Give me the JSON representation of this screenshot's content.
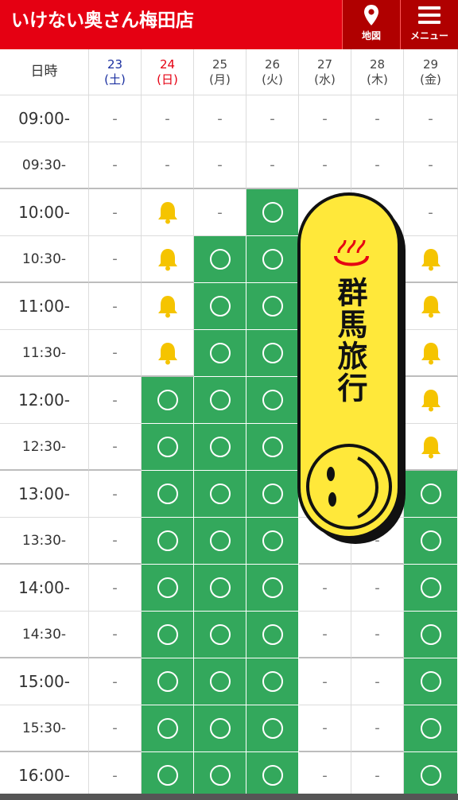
{
  "app": {
    "title": "いけない奥さん梅田店"
  },
  "nav": {
    "map_label": "地図",
    "menu_label": "メニュー",
    "map_icon": "map-pin-icon",
    "menu_icon": "hamburger-menu-icon"
  },
  "table": {
    "corner_label": "日時",
    "days": [
      {
        "date": "23",
        "weekday": "(土)",
        "type": "sat"
      },
      {
        "date": "24",
        "weekday": "(日)",
        "type": "sun"
      },
      {
        "date": "25",
        "weekday": "(月)",
        "type": "weekday"
      },
      {
        "date": "26",
        "weekday": "(火)",
        "type": "weekday"
      },
      {
        "date": "27",
        "weekday": "(水)",
        "type": "weekday"
      },
      {
        "date": "28",
        "weekday": "(木)",
        "type": "weekday"
      },
      {
        "date": "29",
        "weekday": "(金)",
        "type": "weekday"
      }
    ],
    "rows": [
      {
        "time": "09:00-",
        "cells": [
          "-",
          "-",
          "-",
          "-",
          "-",
          "-",
          "-"
        ]
      },
      {
        "time": "09:30-",
        "cells": [
          "-",
          "-",
          "-",
          "-",
          "-",
          "-",
          "-"
        ]
      },
      {
        "time": "10:00-",
        "cells": [
          "-",
          "bell",
          "-",
          "○",
          "",
          "",
          "-"
        ]
      },
      {
        "time": "10:30-",
        "cells": [
          "-",
          "bell",
          "○",
          "○",
          "",
          "",
          "bell"
        ]
      },
      {
        "time": "11:00-",
        "cells": [
          "-",
          "bell",
          "○",
          "○",
          "",
          "",
          "bell"
        ]
      },
      {
        "time": "11:30-",
        "cells": [
          "-",
          "bell",
          "○",
          "○",
          "",
          "",
          "bell"
        ]
      },
      {
        "time": "12:00-",
        "cells": [
          "-",
          "○",
          "○",
          "○",
          "",
          "",
          "bell"
        ]
      },
      {
        "time": "12:30-",
        "cells": [
          "-",
          "○",
          "○",
          "○",
          "",
          "",
          "bell"
        ]
      },
      {
        "time": "13:00-",
        "cells": [
          "-",
          "○",
          "○",
          "○",
          "",
          "",
          "○"
        ]
      },
      {
        "time": "13:30-",
        "cells": [
          "-",
          "○",
          "○",
          "○",
          "",
          "-",
          "○"
        ]
      },
      {
        "time": "14:00-",
        "cells": [
          "-",
          "○",
          "○",
          "○",
          "-",
          "-",
          "○"
        ]
      },
      {
        "time": "14:30-",
        "cells": [
          "-",
          "○",
          "○",
          "○",
          "-",
          "-",
          "○"
        ]
      },
      {
        "time": "15:00-",
        "cells": [
          "-",
          "○",
          "○",
          "○",
          "-",
          "-",
          "○"
        ]
      },
      {
        "time": "15:30-",
        "cells": [
          "-",
          "○",
          "○",
          "○",
          "-",
          "-",
          "○"
        ]
      },
      {
        "time": "16:00-",
        "cells": [
          "-",
          "○",
          "○",
          "○",
          "-",
          "-",
          "○"
        ]
      }
    ]
  },
  "sticker": {
    "text": "群馬旅行",
    "icon": "hot-spring-icon",
    "face_icon": "smiley-face-icon"
  },
  "colors": {
    "brand_red": "#e50012",
    "available_green": "#33a85c",
    "bell_yellow": "#f5c400",
    "sticker_yellow": "#ffe83a"
  }
}
